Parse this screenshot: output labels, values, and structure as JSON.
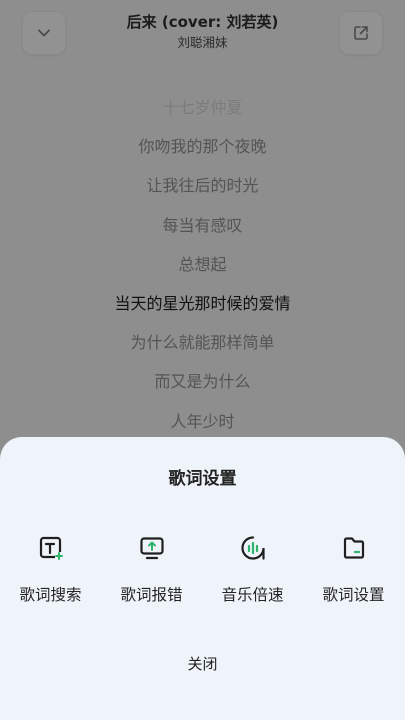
{
  "header": {
    "title": "后来 (cover: 刘若英)",
    "artist": "刘聪湘妹"
  },
  "lyrics": [
    "十七岁仲夏",
    "你吻我的那个夜晚",
    "让我往后的时光",
    "每当有感叹",
    "总想起",
    "当天的星光那时候的爱情",
    "为什么就能那样简单",
    "而又是为什么",
    "人年少时"
  ],
  "active_lyric_index": 5,
  "sheet": {
    "title": "歌词设置",
    "options": [
      {
        "label": "歌词搜索",
        "icon": "lyric-search-icon"
      },
      {
        "label": "歌词报错",
        "icon": "lyric-report-icon"
      },
      {
        "label": "音乐倍速",
        "icon": "playback-speed-icon"
      },
      {
        "label": "歌词设置",
        "icon": "lyric-settings-icon"
      }
    ],
    "close_label": "关闭"
  },
  "colors": {
    "accent": "#2db46a",
    "sheet_bg": "#eff4fb",
    "overlay_bg": "#8e8e8e"
  }
}
